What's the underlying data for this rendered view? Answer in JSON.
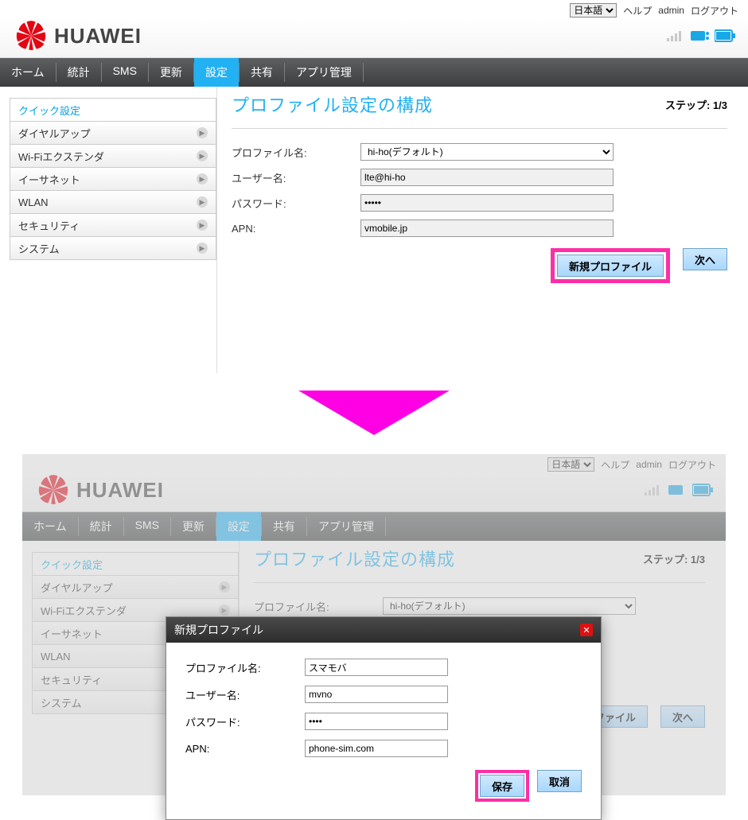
{
  "top": {
    "lang_options": [
      "日本語"
    ],
    "help": "ヘルプ",
    "user": "admin",
    "logout": "ログアウト"
  },
  "brand": "HUAWEI",
  "nav": {
    "home": "ホーム",
    "stats": "統計",
    "sms": "SMS",
    "update": "更新",
    "settings": "設定",
    "share": "共有",
    "appmgr": "アプリ管理"
  },
  "sidebar": {
    "quick": "クイック設定",
    "dialup": "ダイヤルアップ",
    "wifiext": "Wi-Fiエクステンダ",
    "ethernet": "イーサネット",
    "wlan": "WLAN",
    "security": "セキュリティ",
    "system": "システム"
  },
  "page": {
    "title": "プロファイル設定の構成",
    "step": "ステップ: 1/3",
    "profile_label": "プロファイル名:",
    "profile_value": "hi-ho(デフォルト)",
    "user_label": "ユーザー名:",
    "user_value": "lte@hi-ho",
    "pass_label": "パスワード:",
    "pass_value": "•••••",
    "apn_label": "APN:",
    "apn_value": "vmobile.jp",
    "new_profile_btn": "新規プロファイル",
    "next_btn": "次へ"
  },
  "dialog": {
    "title": "新規プロファイル",
    "profile_label": "プロファイル名:",
    "profile_value": "スマモバ",
    "user_label": "ユーザー名:",
    "user_value": "mvno",
    "pass_label": "パスワード:",
    "pass_value": "••••",
    "apn_label": "APN:",
    "apn_value": "phone-sim.com",
    "save_btn": "保存",
    "cancel_btn": "取消"
  },
  "panel2_page": {
    "profile_value": "hi-ho(デフォルト)",
    "btn_profile_trunc": "ロファイル",
    "next_btn": "次へ"
  }
}
